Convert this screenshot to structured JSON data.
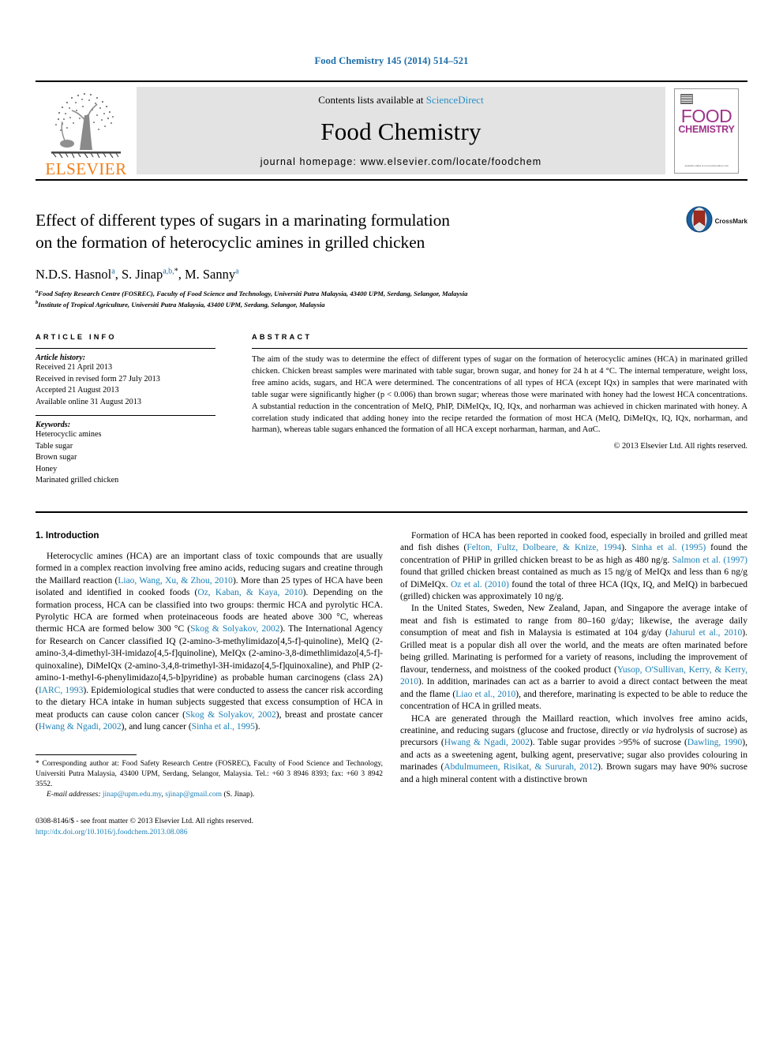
{
  "running_head": "Food Chemistry 145 (2014) 514–521",
  "masthead": {
    "contents_prefix": "Contents lists available at ",
    "sciencedirect": "ScienceDirect",
    "journal_title": "Food Chemistry",
    "homepage": "journal homepage: www.elsevier.com/locate/foodchem",
    "publisher_wordmark": "ELSEVIER",
    "cover": {
      "line1": "FOOD",
      "line2": "CHEMISTRY",
      "footer": "Available online at www.sciencedirect.com"
    },
    "accent_color": "#2a8fc4",
    "elsevier_orange": "#f07f18",
    "cover_magenta": "#a0348a"
  },
  "article": {
    "title_line1": "Effect of different types of sugars in a marinating formulation",
    "title_line2": "on the formation of heterocyclic amines in grilled chicken",
    "authors": [
      {
        "name": "N.D.S. Hasnol",
        "marks": "a"
      },
      {
        "name": "S. Jinap",
        "marks": "a,b,"
      },
      {
        "name": "M. Sanny",
        "marks": "a"
      }
    ],
    "affiliations": [
      {
        "mark": "a",
        "text": "Food Safety Research Centre (FOSREC), Faculty of Food Science and Technology, Universiti Putra Malaysia, 43400 UPM, Serdang, Selangor, Malaysia"
      },
      {
        "mark": "b",
        "text": "Institute of Tropical Agriculture, Universiti Putra Malaysia, 43400 UPM, Serdang, Selangor, Malaysia"
      }
    ],
    "crossmark_label": "CrossMark"
  },
  "info": {
    "heading": "ARTICLE INFO",
    "history_label": "Article history:",
    "history": [
      "Received 21 April 2013",
      "Received in revised form 27 July 2013",
      "Accepted 21 August 2013",
      "Available online 31 August 2013"
    ],
    "keywords_label": "Keywords:",
    "keywords": [
      "Heterocyclic amines",
      "Table sugar",
      "Brown sugar",
      "Honey",
      "Marinated grilled chicken"
    ]
  },
  "abstract": {
    "heading": "ABSTRACT",
    "text": "The aim of the study was to determine the effect of different types of sugar on the formation of heterocyclic amines (HCA) in marinated grilled chicken. Chicken breast samples were marinated with table sugar, brown sugar, and honey for 24 h at 4 °C. The internal temperature, weight loss, free amino acids, sugars, and HCA were determined. The concentrations of all types of HCA (except IQx) in samples that were marinated with table sugar were significantly higher (p < 0.006) than brown sugar; whereas those were marinated with honey had the lowest HCA concentrations. A substantial reduction in the concentration of MeIQ, PhIP, DiMeIQx, IQ, IQx, and norharman was achieved in chicken marinated with honey. A correlation study indicated that adding honey into the recipe retarded the formation of most HCA (MeIQ, DiMeIQx, IQ, IQx, norharman, and harman), whereas table sugars enhanced the formation of all HCA except norharman, harman, and AαC.",
    "copyright": "© 2013 Elsevier Ltd. All rights reserved."
  },
  "body": {
    "section_heading": "1. Introduction",
    "left_paragraphs": [
      "Heterocyclic amines (HCA) are an important class of toxic compounds that are usually formed in a complex reaction involving free amino acids, reducing sugars and creatine through the Maillard reaction (Liao, Wang, Xu, & Zhou, 2010). More than 25 types of HCA have been isolated and identified in cooked foods (Oz, Kaban, & Kaya, 2010). Depending on the formation process, HCA can be classified into two groups: thermic HCA and pyrolytic HCA. Pyrolytic HCA are formed when proteinaceous foods are heated above 300 °C, whereas thermic HCA are formed below 300 °C (Skog & Solyakov, 2002). The International Agency for Research on Cancer classified IQ (2-amino-3-methylimidazo[4,5-f]-quinoline), MeIQ (2-amino-3,4-dimethyl-3H-imidazo[4,5-f]quinoline), MeIQx (2-amino-3,8-dimethlimidazo[4,5-f]-quinoxaline), DiMeIQx (2-amino-3,4,8-trimethyl-3H-imidazo[4,5-f]quinoxaline), and PhIP (2-amino-1-methyl-6-phenylimidazo[4,5-b]pyridine) as probable human carcinogens (class 2A) (IARC, 1993). Epidemiological studies that were conducted to assess the cancer risk according to the dietary HCA intake in human subjects suggested that excess consumption of HCA in meat products can cause colon cancer (Skog & Solyakov, 2002), breast and prostate cancer (Hwang & Ngadi, 2002), and lung cancer (Sinha et al., 1995)."
    ],
    "right_paragraphs": [
      "Formation of HCA has been reported in cooked food, especially in broiled and grilled meat and fish dishes (Felton, Fultz, Dolbeare, & Knize, 1994). Sinha et al. (1995) found the concentration of PHiP in grilled chicken breast to be as high as 480 ng/g. Salmon et al. (1997) found that grilled chicken breast contained as much as 15 ng/g of MeIQx and less than 6 ng/g of DiMeIQx. Oz et al. (2010) found the total of three HCA (IQx, IQ, and MeIQ) in barbecued (grilled) chicken was approximately 10 ng/g.",
      "In the United States, Sweden, New Zealand, Japan, and Singapore the average intake of meat and fish is estimated to range from 80–160 g/day; likewise, the average daily consumption of meat and fish in Malaysia is estimated at 104 g/day (Jahurul et al., 2010). Grilled meat is a popular dish all over the world, and the meats are often marinated before being grilled. Marinating is performed for a variety of reasons, including the improvement of flavour, tenderness, and moistness of the cooked product (Yusop, O'Sullivan, Kerry, & Kerry, 2010). In addition, marinades can act as a barrier to avoid a direct contact between the meat and the flame (Liao et al., 2010), and therefore, marinating is expected to be able to reduce the concentration of HCA in grilled meats.",
      "HCA are generated through the Maillard reaction, which involves free amino acids, creatinine, and reducing sugars (glucose and fructose, directly or via hydrolysis of sucrose) as precursors (Hwang & Ngadi, 2002). Table sugar provides >95% of sucrose (Dawling, 1990), and acts as a sweetening agent, bulking agent, preservative; sugar also provides colouring in marinades (Abdulmumeen, Risikat, & Sururah, 2012). Brown sugars may have 90% sucrose and a high mineral content with a distinctive brown"
    ]
  },
  "footnote": {
    "corresponding": "* Corresponding author at: Food Safety Research Centre (FOSREC), Faculty of Food Science and Technology, Universiti Putra Malaysia, 43400 UPM, Serdang, Selangor, Malaysia. Tel.: +60 3 8946 8393; fax: +60 3 8942 3552.",
    "email_label": "E-mail addresses:",
    "email1": "jinap@upm.edu.my",
    "email2": "sjinap@gmail.com",
    "email_suffix": "(S. Jinap).",
    "issn_line": "0308-8146/$ - see front matter © 2013 Elsevier Ltd. All rights reserved.",
    "doi": "http://dx.doi.org/10.1016/j.foodchem.2013.08.086"
  },
  "colors": {
    "link_blue": "#1b7fb5",
    "head_blue": "#1b6ca8",
    "panel_gray": "#e3e3e3"
  }
}
